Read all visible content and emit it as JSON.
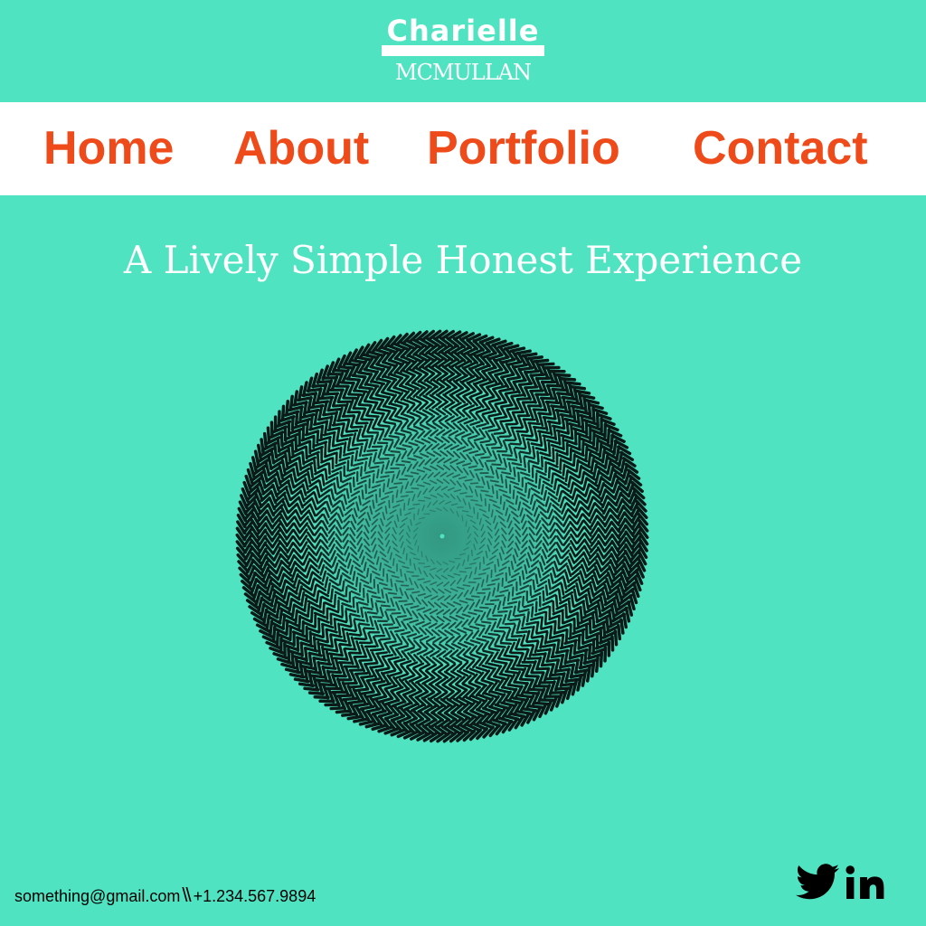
{
  "logo": {
    "first_name": "Charielle",
    "last_name": "MCMULLAN"
  },
  "nav": {
    "items": [
      {
        "label": "Home"
      },
      {
        "label": "About"
      },
      {
        "label": "Portfolio"
      },
      {
        "label": "Contact"
      }
    ]
  },
  "hero": {
    "tagline": "A Lively Simple Honest Experience",
    "image_icon": "op-art-spiral-circle"
  },
  "footer": {
    "email": "something@gmail.com",
    "separator": "\\\\",
    "phone": "+1.234.567.9894",
    "social_icons": [
      "twitter-icon",
      "linkedin-icon"
    ]
  },
  "colors": {
    "background": "#50E3C2",
    "nav_background": "#FFFFFF",
    "nav_text": "#EE4A1A",
    "logo_text": "#FFFFFF",
    "tagline_text": "#FFFFFF",
    "footer_text": "#000000",
    "illusion_dark": "#0B1A16",
    "illusion_center": "#2F8F7A"
  }
}
